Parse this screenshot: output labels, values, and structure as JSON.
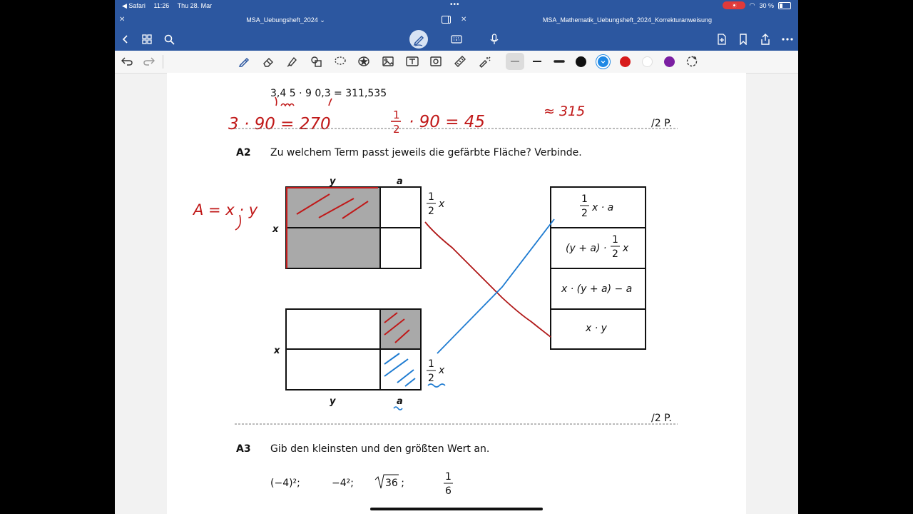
{
  "status_bar": {
    "back_app": "◀ Safari",
    "time": "11:26",
    "date": "Thu 28. Mar",
    "battery": "30 %"
  },
  "tabs": [
    {
      "title": "MSA_Uebungsheft_2024 ⌄"
    },
    {
      "title": "MSA_Mathematik_Uebungsheft_2024_Korrekturanweisung"
    }
  ],
  "toolbar": {
    "colors": [
      "#111111",
      "#1e88e5",
      "#d81b1b",
      "#ffffff",
      "#7b1fa2"
    ]
  },
  "document": {
    "calc_line": "3,4 5 · 9 0,3 = 311,535",
    "handwritten_red_1": "3 · 90 = 270",
    "handwritten_red_2_num": "1",
    "handwritten_red_2_den": "2",
    "handwritten_red_2_rest": "· 90 = 45",
    "handwritten_red_3": "≈ 315",
    "points_1": "/2 P.",
    "a2_label": "A2",
    "a2_question": "Zu welchem Term passt jeweils die gefärbte Fläche? Verbinde.",
    "handwritten_area": "A = x · y",
    "label_y": "y",
    "label_a": "a",
    "label_x": "x",
    "half_num": "1",
    "half_den": "2",
    "term_1_pre": "x · a",
    "term_2_pre": "(y + a) ·",
    "term_2_post": "x",
    "term_3": "x · (y + a) − a",
    "term_4": "x · y",
    "points_2": "/2 P.",
    "a3_label": "A3",
    "a3_question": "Gib den kleinsten und den größten Wert an.",
    "a3_v1": "(−4)²;",
    "a3_v2": "−4²;",
    "a3_v3": "36 ;",
    "a3_v4_num": "1",
    "a3_v4_den": "6"
  }
}
